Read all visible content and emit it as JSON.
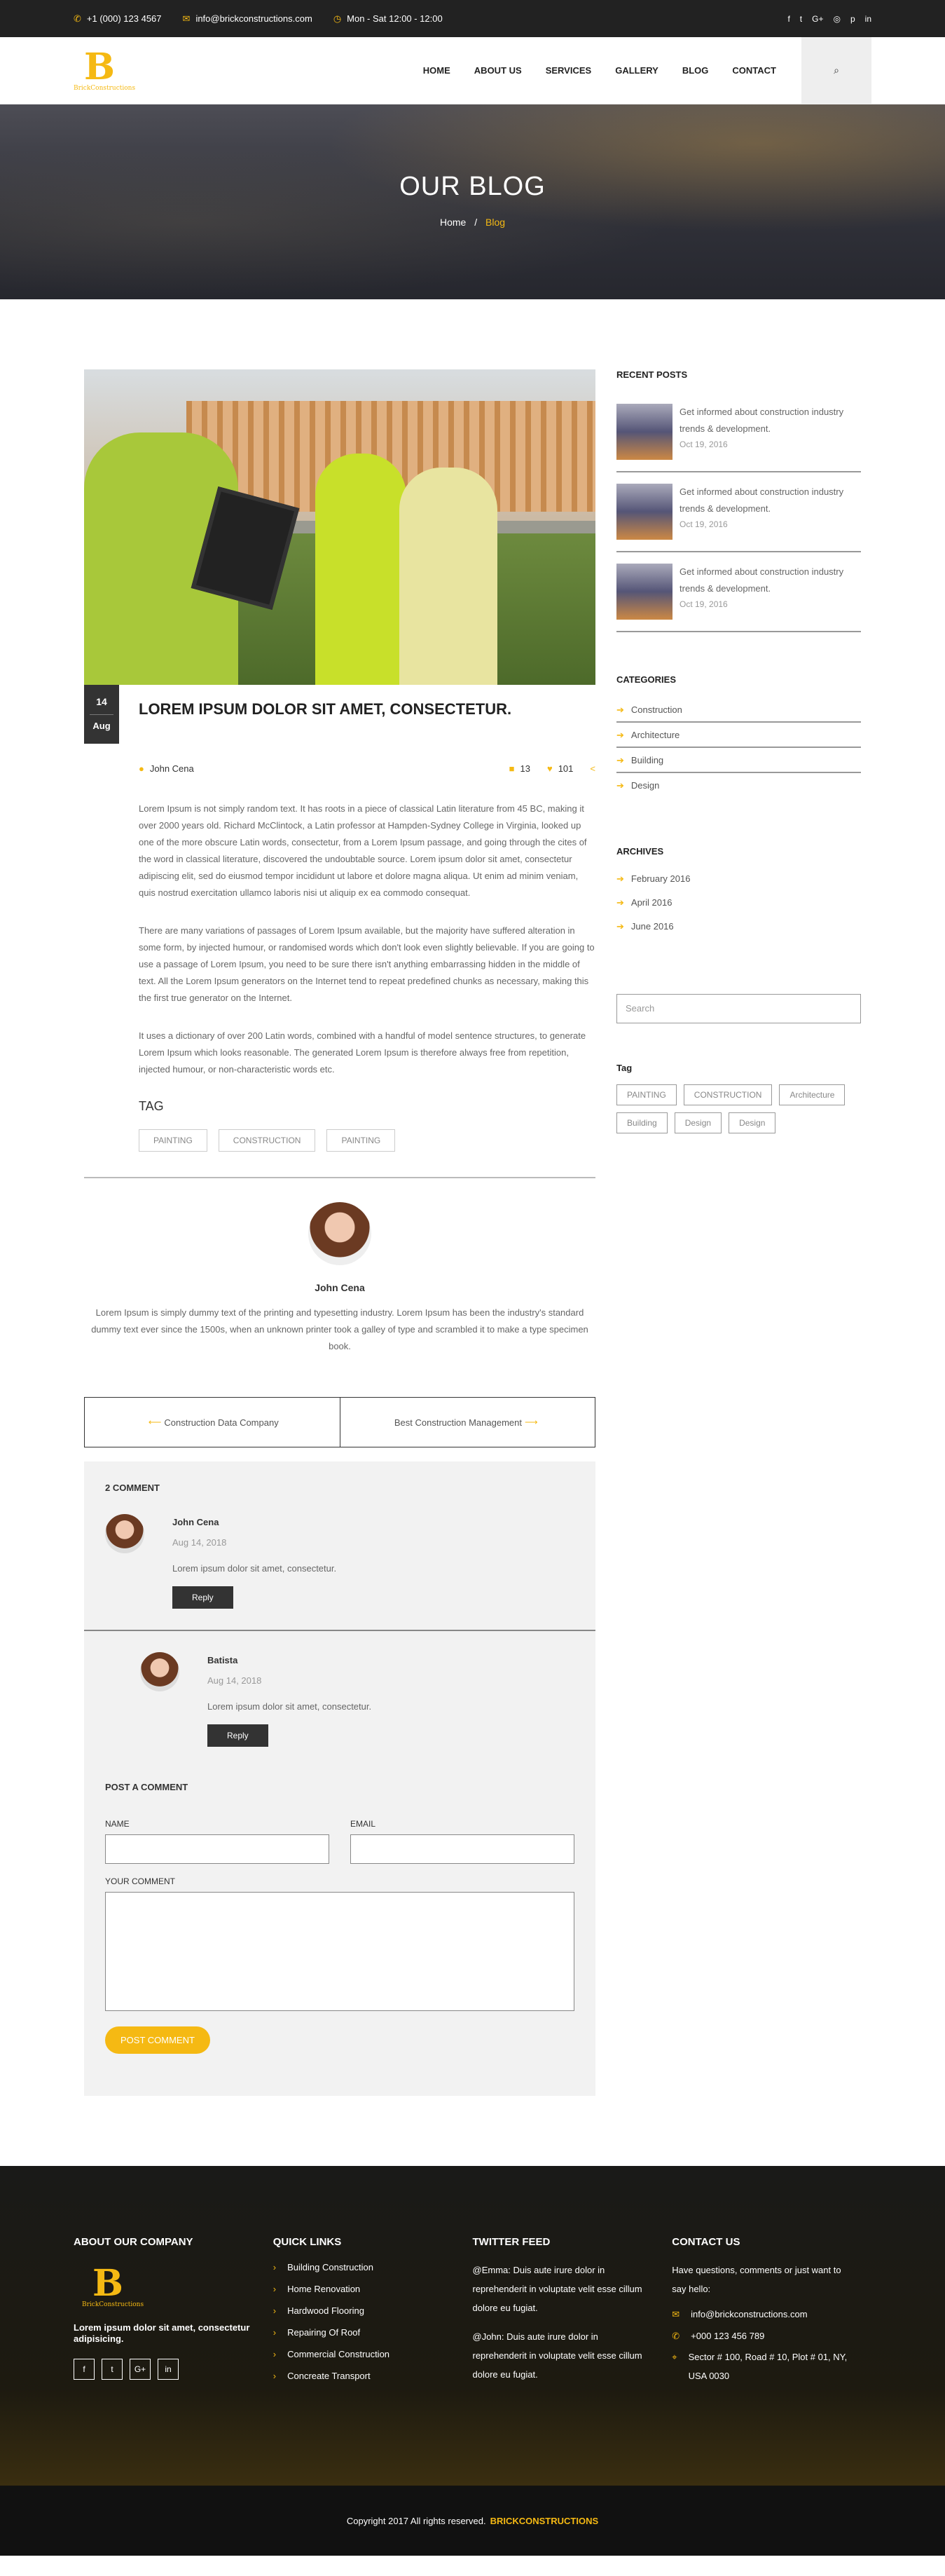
{
  "topbar": {
    "phone": "+1 (000) 123 4567",
    "email": "info@brickconstructions.com",
    "hours": "Mon - Sat 12:00 - 12:00",
    "social": [
      "f",
      "t",
      "G+",
      "◎",
      "p",
      "in"
    ]
  },
  "logo": {
    "letter": "B",
    "name": "BrickConstructions"
  },
  "nav": [
    "HOME",
    "ABOUT US",
    "SERVICES",
    "GALLERY",
    "BLOG",
    "CONTACT"
  ],
  "hero": {
    "title": "OUR BLOG",
    "crumb_home": "Home",
    "crumb_sep": "/",
    "crumb_current": "Blog"
  },
  "post": {
    "day": "14",
    "month": "Aug",
    "title": "LOREM IPSUM DOLOR SIT AMET, CONSECTETUR.",
    "author": "John Cena",
    "comments": "13",
    "likes": "101",
    "paragraphs": [
      "Lorem Ipsum is not simply random text. It has roots in a piece of classical Latin literature from 45 BC, making it over 2000 years old. Richard McClintock, a Latin professor at Hampden-Sydney College in Virginia, looked up one of the more obscure Latin words, consectetur, from a Lorem Ipsum passage, and going through the cites of the word in classical literature, discovered the undoubtable source. Lorem ipsum dolor sit amet, consectetur adipiscing elit, sed do eiusmod tempor incididunt ut labore et dolore magna aliqua. Ut enim ad minim veniam, quis nostrud exercitation ullamco laboris nisi ut aliquip ex ea commodo consequat.",
      "There are many variations of passages of Lorem Ipsum available, but the majority have suffered alteration in some form, by injected humour, or randomised words which don't look even slightly believable. If you are going to use a passage of Lorem Ipsum, you need to be sure there isn't anything embarrassing hidden in the middle of text. All the Lorem Ipsum generators on the Internet tend to repeat predefined chunks as necessary, making this the first true generator on the Internet.",
      "It uses a dictionary of over 200 Latin words, combined with a handful of model sentence structures, to generate Lorem Ipsum which looks reasonable. The generated Lorem Ipsum is therefore always free from repetition, injected humour, or non-characteristic words etc."
    ],
    "tag_heading": "TAG",
    "tags": [
      "PAINTING",
      "CONSTRUCTION",
      "PAINTING"
    ]
  },
  "author_box": {
    "name": "John Cena",
    "bio": "Lorem Ipsum is simply dummy text of the printing and typesetting industry. Lorem Ipsum has been the industry's standard dummy text ever since the 1500s, when an unknown printer took a galley of type and scrambled it to make a type specimen book."
  },
  "post_nav": {
    "prev": "Construction Data Company",
    "next": "Best Construction Management"
  },
  "comments": {
    "heading": "2 COMMENT",
    "items": [
      {
        "name": "John Cena",
        "date": "Aug 14, 2018",
        "text": "Lorem ipsum dolor sit amet, consectetur.",
        "reply": "Reply"
      },
      {
        "name": "Batista",
        "date": "Aug 14, 2018",
        "text": "Lorem ipsum dolor sit amet, consectetur.",
        "reply": "Reply"
      }
    ]
  },
  "form": {
    "heading": "POST A COMMENT",
    "name_label": "NAME",
    "email_label": "EMAIL",
    "comment_label": "YOUR COMMENT",
    "submit": "POST COMMENT"
  },
  "sidebar": {
    "recent_heading": "RECENT POSTS",
    "recent": [
      {
        "title": "Get informed about construction industry trends & development.",
        "date": "Oct 19, 2016"
      },
      {
        "title": "Get informed about construction industry trends & development.",
        "date": "Oct 19, 2016"
      },
      {
        "title": "Get informed about construction industry trends & development.",
        "date": "Oct 19, 2016"
      }
    ],
    "categories_heading": "CATEGORIES",
    "categories": [
      "Construction",
      "Architecture",
      "Building",
      "Design"
    ],
    "archives_heading": "ARCHIVES",
    "archives": [
      "February 2016",
      "April 2016",
      "June 2016"
    ],
    "search_placeholder": "Search",
    "tag_heading": "Tag",
    "tags": [
      "PAINTING",
      "CONSTRUCTION",
      "Architecture",
      "Building",
      "Design",
      "Design"
    ]
  },
  "footer": {
    "about_heading": "ABOUT OUR COMPANY",
    "about_text": "Lorem ipsum dolor sit amet, consectetur adipisicing.",
    "social": [
      "f",
      "t",
      "G+",
      "in"
    ],
    "links_heading": "QUICK LINKS",
    "links": [
      "Building Construction",
      "Home Renovation",
      "Hardwood Flooring",
      "Repairing Of Roof",
      "Commercial Construction",
      "Concreate Transport"
    ],
    "twitter_heading": "TWITTER FEED",
    "tweets": [
      "@Emma: Duis aute irure dolor in reprehenderit in voluptate velit esse cillum dolore eu fugiat.",
      "@John: Duis aute irure dolor in reprehenderit in voluptate velit esse cillum dolore eu fugiat."
    ],
    "contact_heading": "CONTACT US",
    "contact_intro": "Have questions, comments or just want to say hello:",
    "contact_email": "info@brickconstructions.com",
    "contact_phone": "+000 123 456 789",
    "contact_address": "Sector # 100, Road # 10, Plot # 01, NY, USA 0030"
  },
  "copyright": {
    "text": "Copyright 2017 All rights reserved.",
    "brand": "BRICKCONSTRUCTIONS"
  },
  "colors": {
    "accent": "#f5b913",
    "dark": "#222222"
  }
}
